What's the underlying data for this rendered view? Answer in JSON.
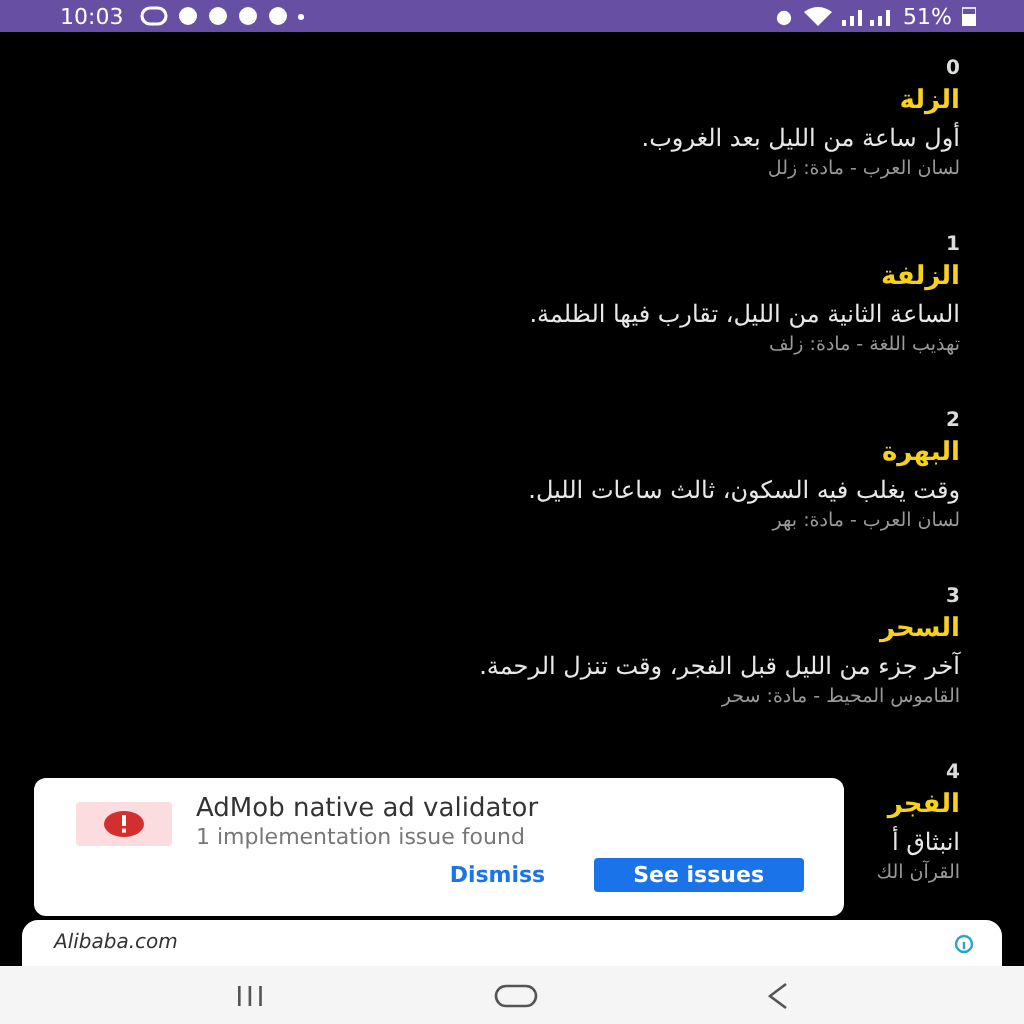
{
  "status_bar": {
    "time": "10:03",
    "battery": "51%"
  },
  "entries": [
    {
      "number": "0",
      "word": "الزلة",
      "definition": "أول ساعة من الليل بعد الغروب.",
      "source": "لسان العرب - مادة: زلل"
    },
    {
      "number": "1",
      "word": "الزلفة",
      "definition": "الساعة الثانية من الليل، تقارب فيها الظلمة.",
      "source": "تهذيب اللغة - مادة: زلف"
    },
    {
      "number": "2",
      "word": "البهرة",
      "definition": "وقت يغلب فيه السكون، ثالث ساعات الليل.",
      "source": "لسان العرب - مادة: بهر"
    },
    {
      "number": "3",
      "word": "السحر",
      "definition": "آخر جزء من الليل قبل الفجر، وقت تنزل الرحمة.",
      "source": "القاموس المحيط - مادة: سحر"
    },
    {
      "number": "4",
      "word": "الفجر",
      "definition": "انبثاق أ",
      "source": "القرآن الك"
    }
  ],
  "popup": {
    "title": "AdMob native ad validator",
    "message": "1 implementation issue found",
    "dismiss_button": "Dismiss",
    "see_issues_button": "See issues"
  },
  "ad_banner": {
    "text": "Alibaba.com"
  }
}
